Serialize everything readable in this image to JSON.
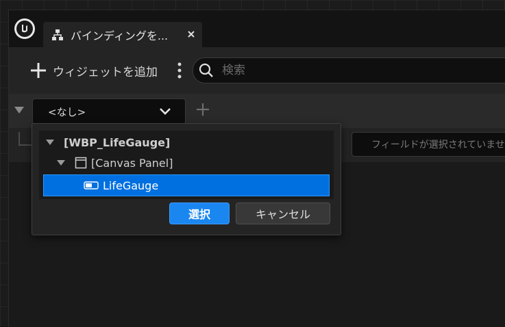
{
  "tab": {
    "title": "バインディングを..."
  },
  "toolbar": {
    "add_widget_label": "ウィジェットを追加",
    "search_placeholder": "検索"
  },
  "binding": {
    "combo_value": "<なし>",
    "field_placeholder": "フィールドが選択されていません"
  },
  "popup": {
    "tree": {
      "root": "[WBP_LifeGauge]",
      "canvas": "[Canvas Panel]",
      "selected": "LifeGauge"
    },
    "select_label": "選択",
    "cancel_label": "キャンセル"
  },
  "colors": {
    "accent": "#0070e0",
    "button_primary": "#1a86f0"
  }
}
